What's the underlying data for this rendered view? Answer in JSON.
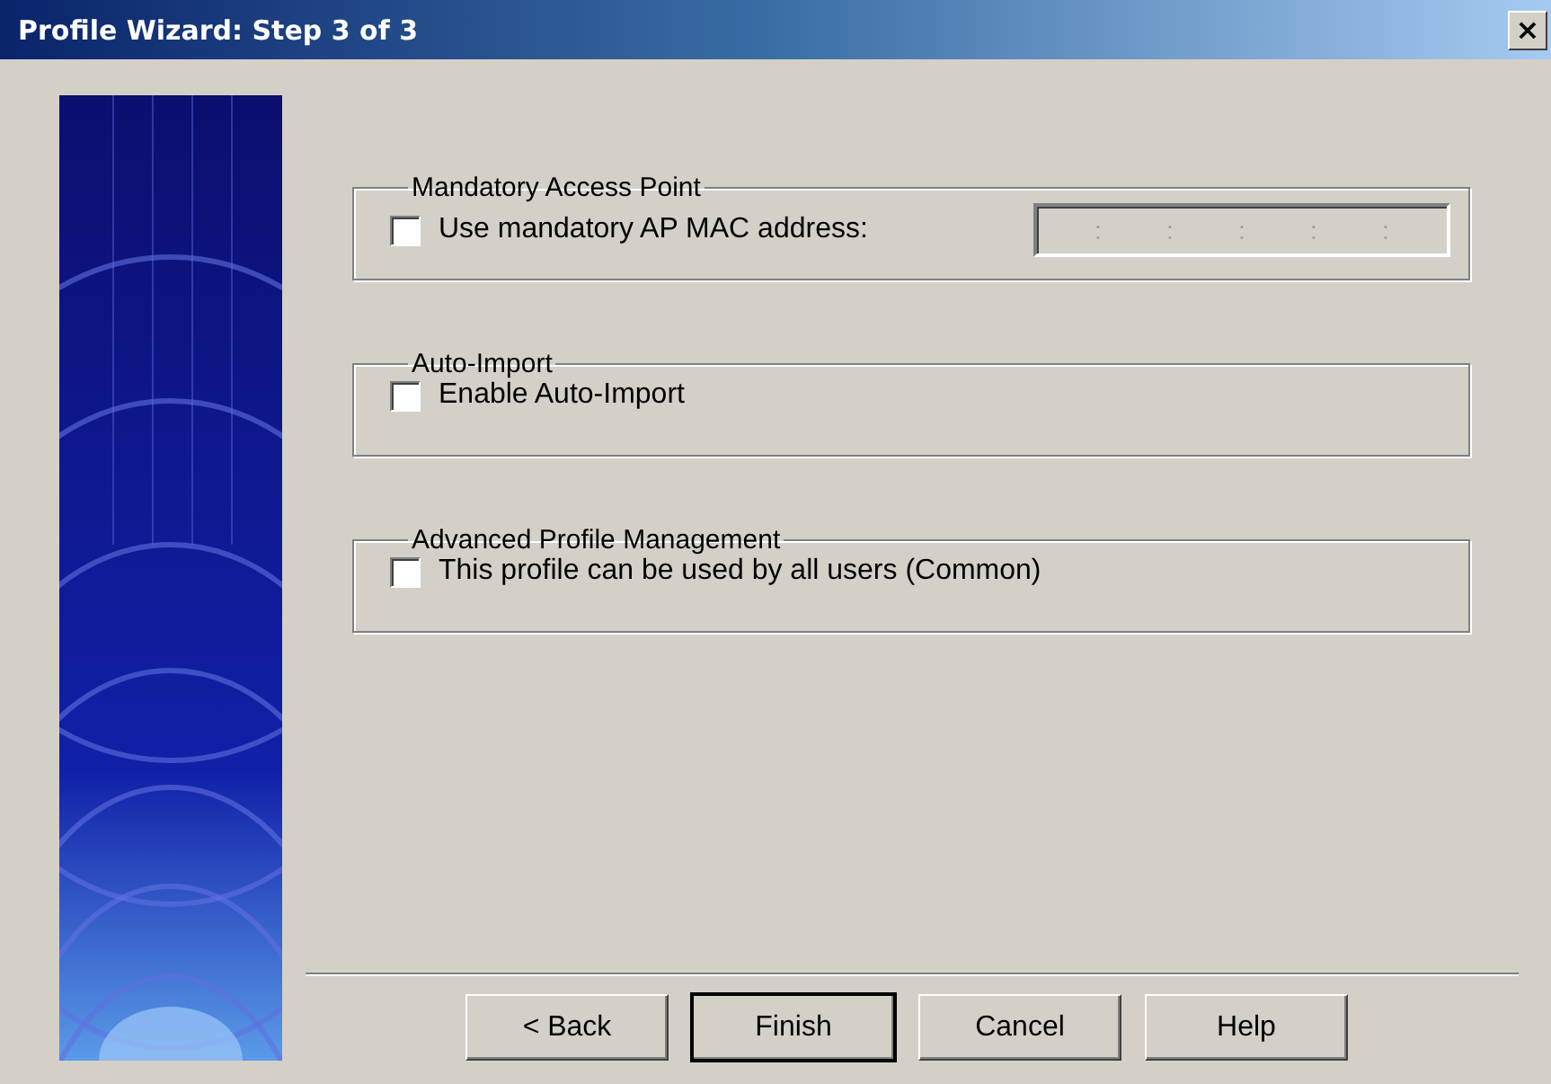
{
  "window": {
    "title": "Profile Wizard: Step 3 of 3",
    "close": "×"
  },
  "groups": [
    {
      "title": "Mandatory Access Point",
      "option": {
        "label": "Use mandatory AP MAC address:",
        "checked": false
      },
      "mac_field": {
        "separators": [
          ":",
          ":",
          ":",
          ":",
          ":"
        ],
        "disabled": true
      }
    },
    {
      "title": "Auto-Import",
      "option": {
        "label": "Enable Auto-Import",
        "checked": false
      }
    },
    {
      "title": "Advanced Profile Management",
      "option": {
        "label": "This profile can be used by all users (Common)",
        "checked": false
      }
    }
  ],
  "buttons": [
    {
      "label": "< Back",
      "default": false
    },
    {
      "label": "Finish",
      "default": true
    },
    {
      "label": "Cancel",
      "default": false
    },
    {
      "label": "Help",
      "default": false
    }
  ]
}
